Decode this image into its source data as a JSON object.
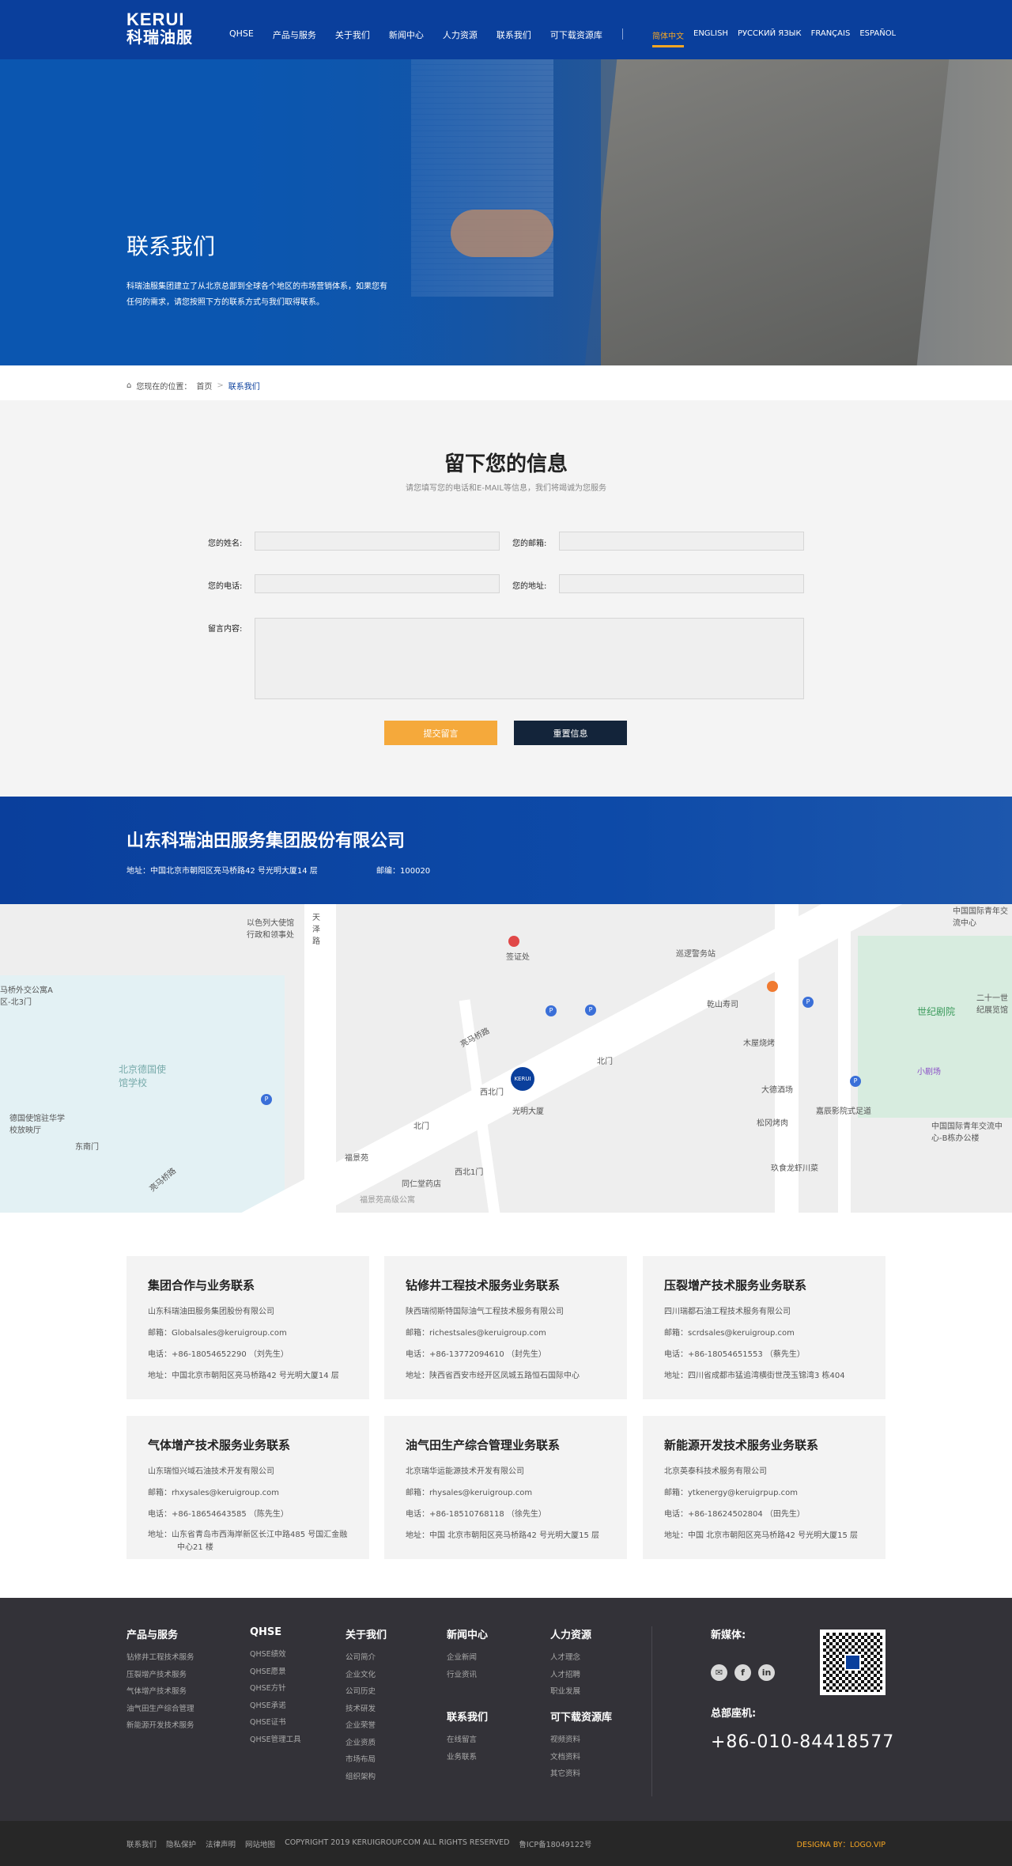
{
  "header": {
    "logo_en": "KERUI",
    "logo_cn": "科瑞油服",
    "nav": [
      "QHSE",
      "产品与服务",
      "关于我们",
      "新闻中心",
      "人力资源",
      "联系我们",
      "可下载资源库"
    ],
    "langs": [
      "简体中文",
      "ENGLISH",
      "РУССКИЙ ЯЗЫК",
      "FRANÇAIS",
      "ESPAÑOL"
    ]
  },
  "hero": {
    "title": "联系我们",
    "desc": "科瑞油服集团建立了从北京总部到全球各个地区的市场营销体系，如果您有任何的需求，请您按照下方的联系方式与我们取得联系。"
  },
  "breadcrumb": {
    "prefix": "您现在的位置：",
    "home": "首页",
    "sep": ">",
    "current": "联系我们"
  },
  "form": {
    "title": "留下您的信息",
    "subtitle": "请您填写您的电话和E-MAIL等信息，我们将竭诚为您服务",
    "name_label": "您的姓名:",
    "email_label": "您的邮箱:",
    "phone_label": "您的电话:",
    "address_label": "您的地址:",
    "message_label": "留言内容:",
    "name_value": "",
    "email_value": "",
    "phone_value": "",
    "address_value": "",
    "message_value": "",
    "submit": "提交留言",
    "reset": "重置信息",
    "submit_color": "#f5a93b",
    "reset_color": "#13243a"
  },
  "company": {
    "name": "山东科瑞油田服务集团股份有限公司",
    "address": "地址：中国北京市朝阳区亮马桥路42 号光明大厦14 层",
    "zip": "邮编：100020"
  },
  "map": {
    "labels": [
      "以色列大使馆行政和领事处",
      "天泽路",
      "签证处",
      "巡逻警务站",
      "马桥外交公寓A区-北3门",
      "亮马桥路",
      "乾山寿司",
      "世纪剧院",
      "二十一世纪展览馆",
      "北京德国使馆学校",
      "木屋烧烤",
      "北门",
      "小剧场",
      "西北门",
      "光明大厦",
      "大德酒场",
      "德国使馆驻华学校放映厅",
      "嘉辰影院式足道",
      "松冈烤肉",
      "中国国际青年交流中心-B栋办公楼",
      "东南门",
      "北门",
      "福景苑",
      "西北1门",
      "玖食龙虾川菜",
      "同仁堂药店",
      "福景苑高级公寓",
      "亮马桥路",
      "中国国际青年交流中心"
    ],
    "marker": "KERUI"
  },
  "contacts": [
    {
      "title": "集团合作与业务联系",
      "company": "山东科瑞油田服务集团股份有限公司",
      "email": "邮箱：Globalsales@keruigroup.com",
      "phone": "电话：+86-18054652290 （刘先生）",
      "address": "地址：中国北京市朝阳区亮马桥路42 号光明大厦14 层"
    },
    {
      "title": "钻修井工程技术服务业务联系",
      "company": "陕西瑞彻斯特国际油气工程技术服务有限公司",
      "email": "邮箱：richestsales@keruigroup.com",
      "phone": "电话：+86-13772094610 （封先生）",
      "address": "地址：陕西省西安市经开区凤城五路恒石国际中心"
    },
    {
      "title": "压裂增产技术服务业务联系",
      "company": "四川瑞都石油工程技术服务有限公司",
      "email": "邮箱：scrdsales@keruigroup.com",
      "phone": "电话：+86-18054651553 （蔡先生）",
      "address": "地址：四川省成都市猛追湾横街世茂玉锦湾3 栋404"
    },
    {
      "title": "气体增产技术服务业务联系",
      "company": "山东瑞恒兴域石油技术开发有限公司",
      "email": "邮箱：rhxysales@keruigroup.com",
      "phone": "电话：+86-18654643585 （陈先生）",
      "address": "地址：山东省青岛市西海岸新区长江中路485 号国汇金融中心21 楼"
    },
    {
      "title": "油气田生产综合管理业务联系",
      "company": "北京瑞华运能源技术开发有限公司",
      "email": "邮箱：rhysales@keruigroup.com",
      "phone": "电话：+86-18510768118 （徐先生）",
      "address": "地址：中国 北京市朝阳区亮马桥路42 号光明大厦15 层"
    },
    {
      "title": "新能源开发技术服务业务联系",
      "company": "北京英泰科技术服务有限公司",
      "email": "邮箱：ytkenergy@keruigrpup.com",
      "phone": "电话：+86-18624502804 （田先生）",
      "address": "地址：中国 北京市朝阳区亮马桥路42 号光明大厦15 层"
    }
  ],
  "footer": {
    "cols": [
      {
        "title": "产品与服务",
        "items": [
          "钻修井工程技术服务",
          "压裂增产技术服务",
          "气体增产技术服务",
          "油气田生产综合管理",
          "新能源开发技术服务"
        ]
      },
      {
        "title": "QHSE",
        "items": [
          "QHSE绩效",
          "QHSE愿景",
          "QHSE方针",
          "QHSE承诺",
          "QHSE证书",
          "QHSE管理工具"
        ]
      },
      {
        "title": "关于我们",
        "items": [
          "公司简介",
          "企业文化",
          "公司历史",
          "技术研发",
          "企业荣誉",
          "企业资质",
          "市场布局",
          "组织架构"
        ]
      },
      {
        "title": "新闻中心",
        "items": [
          "企业新闻",
          "行业资讯"
        ]
      },
      {
        "title": "人力资源",
        "items": [
          "人才理念",
          "人才招聘",
          "职业发展"
        ]
      },
      {
        "title": "联系我们",
        "items": [
          "在线留言",
          "业务联系"
        ]
      },
      {
        "title": "可下载资源库",
        "items": [
          "视频资料",
          "文档资料",
          "其它资料"
        ]
      }
    ],
    "social_label": "新媒体:",
    "social": [
      "wechat",
      "f",
      "in"
    ],
    "hotline_label": "总部座机:",
    "hotline": "+86-010-84418577"
  },
  "bottom": {
    "links": [
      "联系我们",
      "隐私保护",
      "法律声明",
      "网站地图"
    ],
    "copyright": "COPYRIGHT 2019 KERUIGROUP.COM ALL RIGHTS RESERVED",
    "icp": "鲁ICP备18049122号",
    "design": "DESIGNA  BY：LOGO.VIP"
  }
}
